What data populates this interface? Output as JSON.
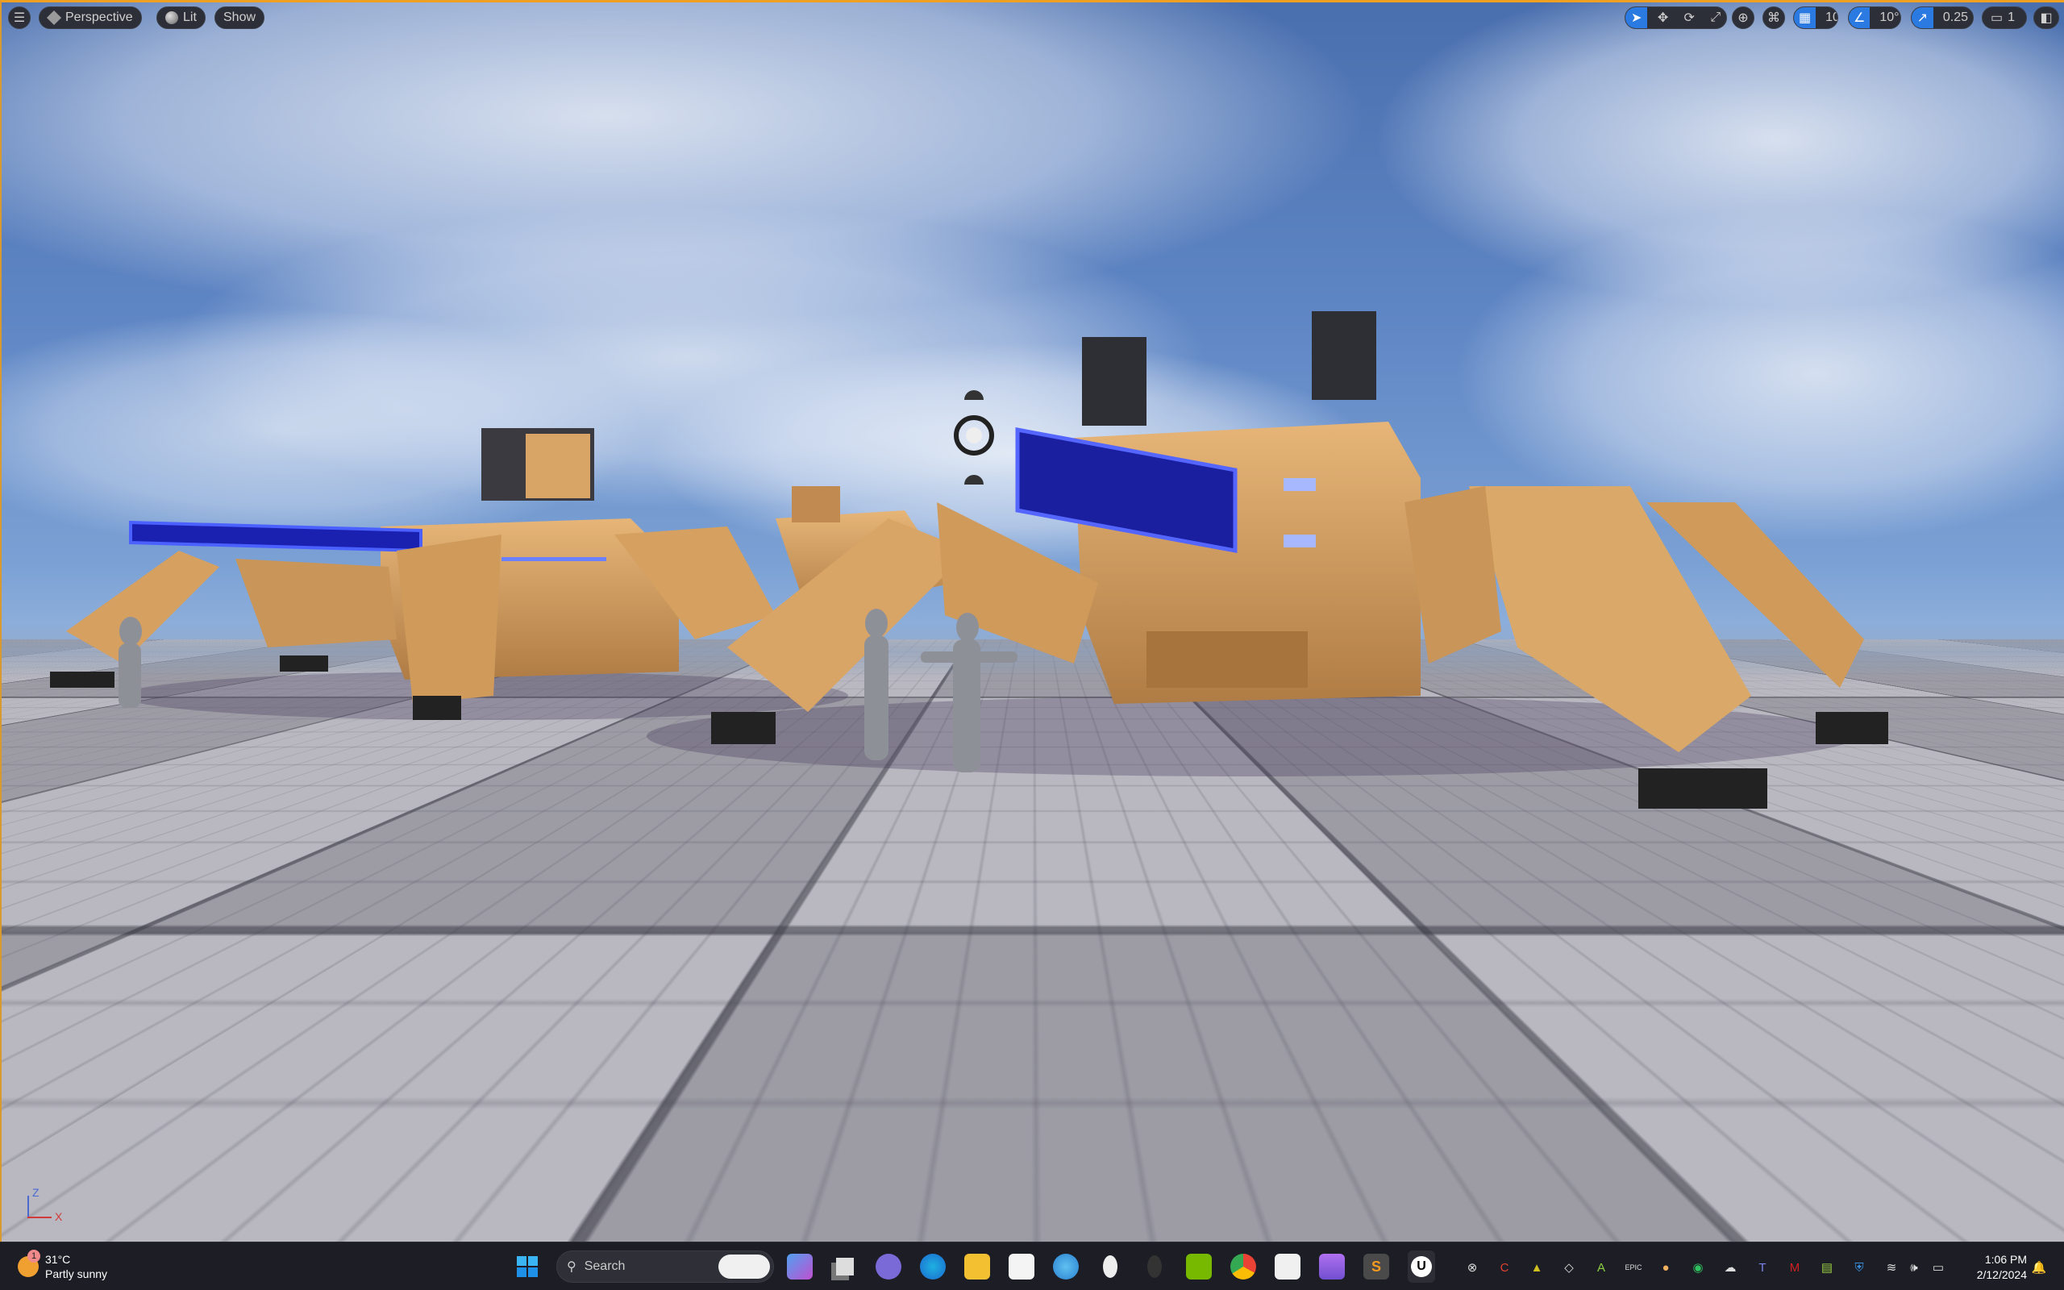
{
  "viewport_toolbar": {
    "view_mode": "Perspective",
    "lighting": "Lit",
    "show": "Show",
    "grid_snap": "10",
    "rotation_snap": "10°",
    "scale_snap": "0.25",
    "camera_speed": "1",
    "accent": "#2a7ae2"
  },
  "axis_gizmo": {
    "z": "Z",
    "x": "X"
  },
  "taskbar": {
    "weather": {
      "temp": "31°C",
      "condition": "Partly sunny",
      "badge": "1"
    },
    "search_placeholder": "Search",
    "apps": [
      "copilot",
      "clipchamp",
      "task-view",
      "teams-meet",
      "edge",
      "file-explorer",
      "microsoft-store",
      "paint",
      "alienware",
      "alienware-dark",
      "nvidia",
      "chrome",
      "snipping-tool",
      "clipchamp-purple",
      "sublime-text",
      "unreal-engine"
    ],
    "tray": [
      "xbox",
      "ccleaner",
      "tray-warning",
      "unity",
      "tray-app-a",
      "epic-games",
      "tray-orb",
      "tray-green",
      "onedrive",
      "teams",
      "mcafee",
      "tray-app-b",
      "windows-security",
      "wifi",
      "volume",
      "battery"
    ],
    "time": "1:06 PM",
    "date": "2/12/2024"
  }
}
